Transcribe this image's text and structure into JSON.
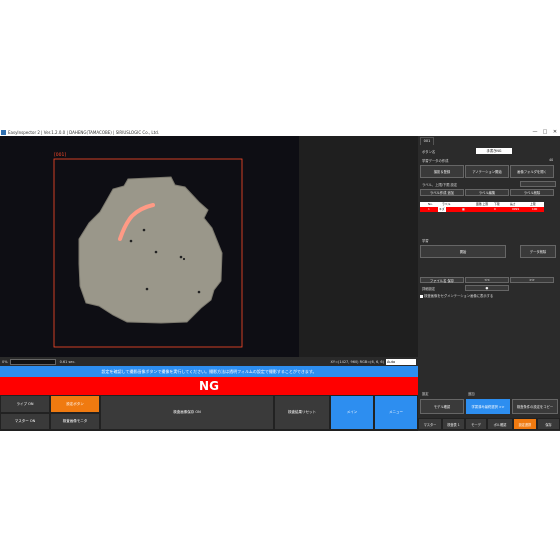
{
  "window": {
    "title": "EasyInspector 2 | Ver.1.2.0.0 | DAHENG(TAMACOBE) | SIRIUSLOGIC Co., Ltd.",
    "controls": [
      "—",
      "□",
      "✕"
    ]
  },
  "viewer": {
    "roi_label": "[001]",
    "zoom_value": "",
    "elapsed": "0.61 sec.",
    "coords": "XY=(1427, 960) RGB=(6, 6, 6)",
    "zoom_select": "Auto"
  },
  "info_message": "設定を確認して撮影画像ボタンで撮像を実行してください。撮影方法は透明フィルムの設定で撮影することができます。",
  "result": {
    "text": "NG",
    "color": "#ff0000"
  },
  "bottom_buttons": {
    "live": "ライブ ON",
    "settings": "設定ボタン",
    "master": "マスター ON",
    "detect_mode": "検査画像モニタ",
    "capture": "検査画像保存 ON",
    "reset": "検査結果リセット",
    "main": "メイン",
    "menu": "メニュー"
  },
  "panel": {
    "tab_id": "001",
    "name_label": "ボタン名",
    "name_value": "手書きNG",
    "section_title": "学習データの作成",
    "count": "40",
    "btn_capture": "撮影＆登録",
    "btn_annotation": "アノテーション開始",
    "btn_image_folder": "画像フォルダを開く",
    "label_title": "ラベル、上限/下限 設定",
    "label_add": "ラベル作成 追加",
    "label_edit": "ラベル編集",
    "label_delete": "ラベル削除",
    "table_headers": [
      "No.",
      "ラベル",
      "",
      "面積 上限",
      "下限",
      "長さ",
      "上限"
    ],
    "table_row": [
      "1",
      "キズ",
      "■",
      "0",
      "9999",
      "100"
    ],
    "learn_title": "学習",
    "btn_start": "開始",
    "btn_data_delete": "データ削除",
    "file_label": "ファイル名 保存",
    "nav_prev": "<<",
    "nav_next": ">>",
    "detail_label": "詳細設定",
    "detail_value": "●",
    "checkbox_label": "検査画像をセグメンテーション画像に表示する",
    "section_b": "設定",
    "section_c": "追加",
    "btn_model": "モデル確認",
    "btn_model_select": "学習済み最終選択 >>",
    "btn_copy": "検査条件の設定をコピー",
    "bottom_tabs": [
      "マスター",
      "検査表 1",
      "モーデ",
      "ボル確認",
      "設定連携",
      "保存"
    ]
  },
  "colors": {
    "accent_blue": "#2d8ef0",
    "accent_orange": "#f07a10",
    "ng_red": "#ff0000",
    "roi_red": "#ff4a2a",
    "mark_pink": "#ff9a85"
  }
}
